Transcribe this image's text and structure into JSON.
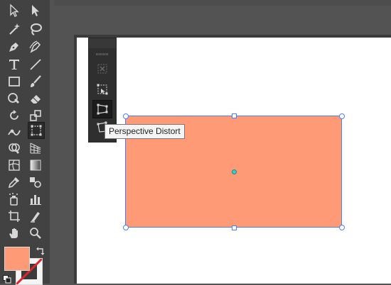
{
  "tooltip": {
    "text": "Perspective Distort"
  },
  "colors": {
    "fill": "#ff9a76",
    "selection": "#4a7dff",
    "panel": "#424242",
    "canvas": "#535353"
  },
  "tools": {
    "left": [
      "selection-icon",
      "magic-wand-icon",
      "pen-icon",
      "type-icon",
      "rectangle-icon",
      "shaper-icon",
      "rotate-icon",
      "warp-icon",
      "shape-builder-icon",
      "mesh-icon",
      "eyedropper-icon",
      "symbol-sprayer-icon",
      "artboard-icon",
      "hand-icon"
    ],
    "right": [
      "direct-selection-icon",
      "lasso-icon",
      "curvature-icon",
      "line-segment-icon",
      "paintbrush-icon",
      "eraser-icon",
      "scale-icon",
      "free-transform-icon",
      "perspective-grid-icon",
      "gradient-icon",
      "blend-icon",
      "column-graph-icon",
      "slice-icon",
      "zoom-icon"
    ]
  },
  "flyout": {
    "items": [
      "constrain-icon",
      "free-transform-icon",
      "perspective-distort-icon",
      "free-distort-icon"
    ],
    "active": "perspective-distort-icon"
  }
}
